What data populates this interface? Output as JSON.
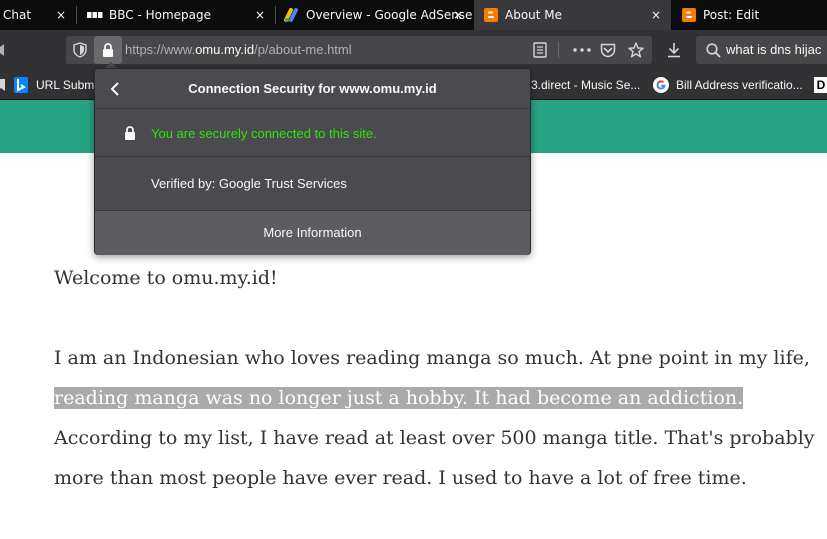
{
  "tabs": [
    {
      "title": "Chat",
      "icon": "chat-icon"
    },
    {
      "title": "BBC - Homepage",
      "icon": "bbc-icon"
    },
    {
      "title": "Overview - Google AdSense",
      "icon": "adsense-icon"
    },
    {
      "title": "About Me",
      "icon": "blogger-icon",
      "active": true
    },
    {
      "title": "Post: Edit",
      "icon": "blogger-icon"
    }
  ],
  "tab_close_glyph": "×",
  "urlbar": {
    "prefix": "https://www.",
    "host": "omu.my.id",
    "path": "/p/about-me.html"
  },
  "searchbar": {
    "value": "what is dns hijac"
  },
  "bookmarks": [
    {
      "label": "URL Submi",
      "icon": "bing-icon"
    },
    {
      "label": "3.direct - Music Se...",
      "icon": "bookmark-icon"
    },
    {
      "label": "Bill Address verificatio...",
      "icon": "google-icon"
    },
    {
      "label": "D",
      "icon": "bookmark-icon"
    }
  ],
  "popup": {
    "title": "Connection Security for www.omu.my.id",
    "secure_message": "You are securely connected to this site.",
    "verified_by": "Verified by: Google Trust Services",
    "more_info": "More Information"
  },
  "page": {
    "welcome": "Welcome to omu.my.id!",
    "lines": [
      "I am an Indonesian who loves reading manga so much. At pne point in my life,",
      "reading manga was no longer just a hobby. It had become an addiction. ",
      "According to my list, I have read at least over 500 manga title. That's probably",
      "more than most people have ever read. I used to have a lot of free time."
    ]
  },
  "colors": {
    "site_header": "#26a382",
    "secure_green": "#30e60b",
    "selection": "#aaaaaa"
  }
}
